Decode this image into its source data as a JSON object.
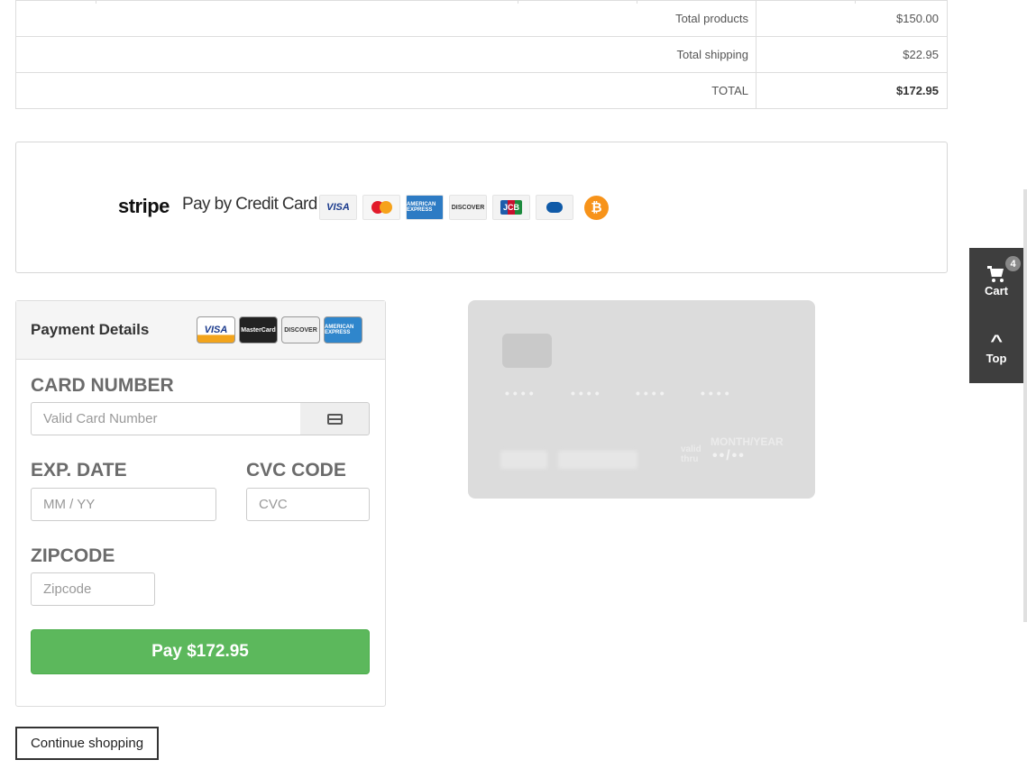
{
  "totals": {
    "rows": [
      {
        "label": "Total products",
        "value": "$150.00"
      },
      {
        "label": "Total shipping",
        "value": "$22.95"
      },
      {
        "label": "TOTAL",
        "value": "$172.95"
      }
    ]
  },
  "stripe": {
    "logo": "stripe",
    "title": "Pay by Credit Card",
    "brands": [
      "VISA",
      "MasterCard",
      "AMERICAN EXPRESS",
      "DISCOVER",
      "JCB",
      "Diners"
    ],
    "bitcoin_symbol": "₿"
  },
  "payment": {
    "title": "Payment Details",
    "head_cards": [
      "VISA",
      "MasterCard",
      "DISCOVER",
      "AMERICAN EXPRESS"
    ],
    "card_number_label": "CARD NUMBER",
    "card_number_placeholder": "Valid Card Number",
    "exp_label": "EXP. DATE",
    "exp_placeholder": "MM / YY",
    "cvc_label": "CVC CODE",
    "cvc_placeholder": "CVC",
    "zip_label": "ZIPCODE",
    "zip_placeholder": "Zipcode",
    "pay_button": "Pay $172.95"
  },
  "card_preview": {
    "number_groups": [
      "••••",
      "••••",
      "••••",
      "••••"
    ],
    "valid_thru": "valid thru",
    "month_year": "MONTH/YEAR",
    "expiry": "••/••"
  },
  "continue_button": "Continue shopping",
  "side": {
    "cart_label": "Cart",
    "cart_count": "4",
    "top_label": "Top"
  }
}
